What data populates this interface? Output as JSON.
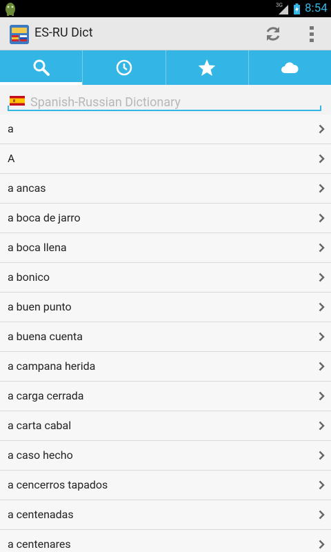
{
  "status": {
    "network": "3G",
    "time": "8:54"
  },
  "app": {
    "title": "ES-RU Dict"
  },
  "tabs": [
    {
      "name": "search"
    },
    {
      "name": "history"
    },
    {
      "name": "favorites"
    },
    {
      "name": "cloud"
    }
  ],
  "search": {
    "placeholder": "Spanish-Russian Dictionary",
    "value": ""
  },
  "words": [
    "a",
    "A",
    "a ancas",
    "a boca de jarro",
    "a boca llena",
    "a bonico",
    "a buen punto",
    "a buena cuenta",
    "a campana herida",
    "a carga cerrada",
    "a carta cabal",
    "a caso hecho",
    "a cencerros tapados",
    "a centenadas",
    "a centenares"
  ],
  "colors": {
    "accent": "#33b5e5",
    "actionbar": "#e8e8e8"
  }
}
